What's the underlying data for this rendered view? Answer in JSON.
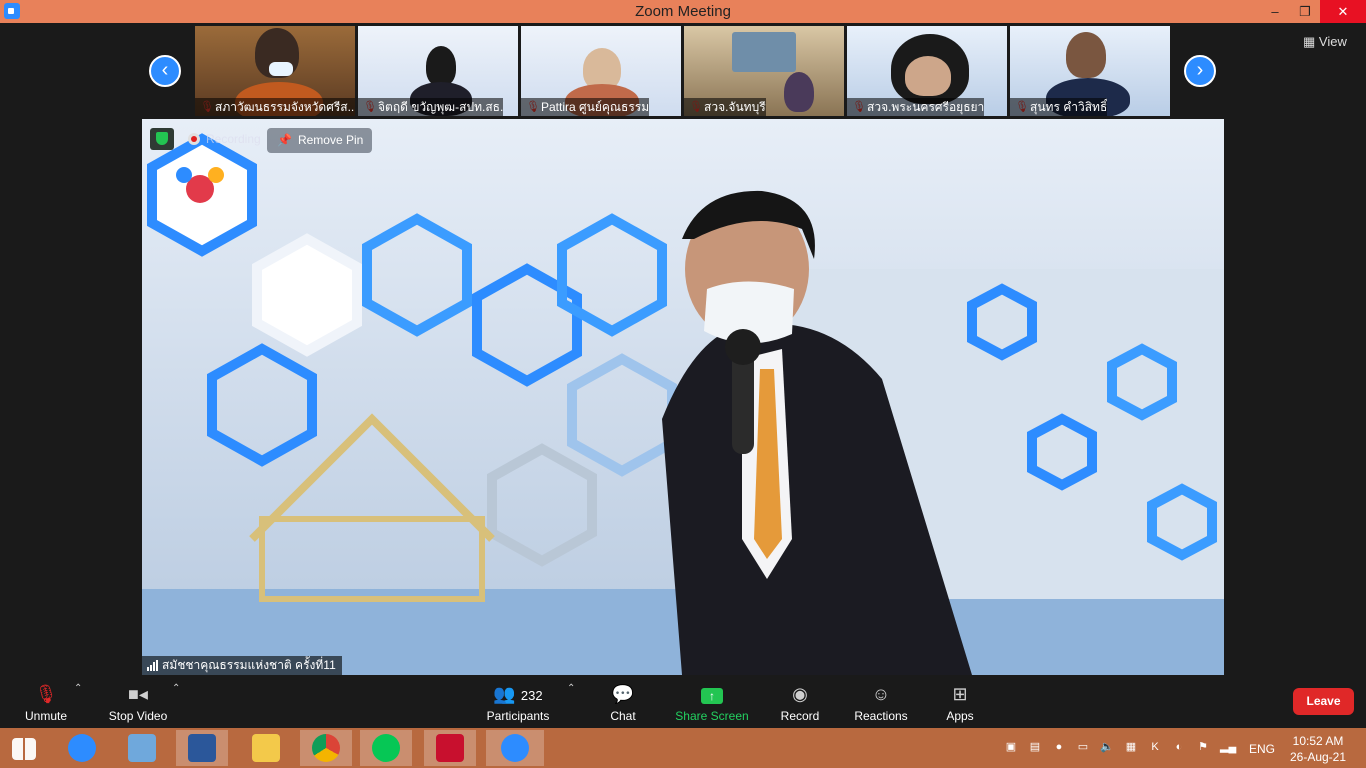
{
  "window": {
    "title": "Zoom Meeting",
    "controls": [
      "–",
      "❐",
      "✕"
    ]
  },
  "view_button": {
    "label": "View"
  },
  "thumbnails": [
    {
      "name": "สภาวัฒนธรรมจังหวัดศรีส..."
    },
    {
      "name": "จิตฤดี ขวัญพุฒ-สปท.สธ."
    },
    {
      "name": "Pattira ศูนย์คุณธรรม"
    },
    {
      "name": "สวจ.จันทบุรี"
    },
    {
      "name": "สวจ.พระนครศรีอยุธยา"
    },
    {
      "name": "สุนทร คำวิสิทธิ์"
    }
  ],
  "main_video": {
    "recording_label": "Recording",
    "remove_pin_label": "Remove Pin",
    "speaker_name": "สมัชชาคุณธรรมแห่งชาติ ครั้งที่11"
  },
  "toolbar": {
    "unmute": "Unmute",
    "stop_video": "Stop Video",
    "participants": "Participants",
    "participants_count": "232",
    "chat": "Chat",
    "share_screen": "Share Screen",
    "record": "Record",
    "reactions": "Reactions",
    "apps": "Apps",
    "leave": "Leave"
  },
  "taskbar": {
    "language": "ENG",
    "time": "10:52 AM",
    "date": "26-Aug-21"
  },
  "colors": {
    "title_bar": "#e8815a",
    "zoom_blue": "#2d8cff",
    "share_green": "#23d160",
    "leave_red": "#e02828",
    "taskbar": "#b8693f"
  }
}
